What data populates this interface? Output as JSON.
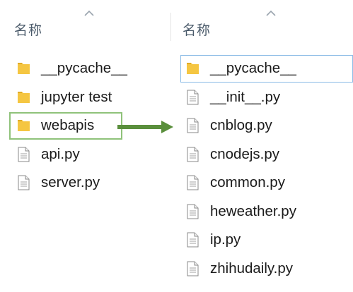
{
  "left_pane": {
    "header": "名称",
    "items": [
      {
        "name": "__pycache__",
        "type": "folder",
        "selected": false
      },
      {
        "name": "jupyter test",
        "type": "folder",
        "selected": false
      },
      {
        "name": "webapis",
        "type": "folder",
        "selected": true
      },
      {
        "name": "api.py",
        "type": "file",
        "selected": false
      },
      {
        "name": "server.py",
        "type": "file",
        "selected": false
      }
    ]
  },
  "right_pane": {
    "header": "名称",
    "items": [
      {
        "name": "__pycache__",
        "type": "folder",
        "focused": true
      },
      {
        "name": "__init__.py",
        "type": "file"
      },
      {
        "name": "cnblog.py",
        "type": "file"
      },
      {
        "name": "cnodejs.py",
        "type": "file"
      },
      {
        "name": "common.py",
        "type": "file"
      },
      {
        "name": "heweather.py",
        "type": "file"
      },
      {
        "name": "ip.py",
        "type": "file"
      },
      {
        "name": "zhihudaily.py",
        "type": "file"
      }
    ]
  },
  "colors": {
    "folder": "#f5c542",
    "selection_border": "#8fc27a",
    "focus_border": "#8cbce6",
    "arrow": "#5a8f3c"
  }
}
